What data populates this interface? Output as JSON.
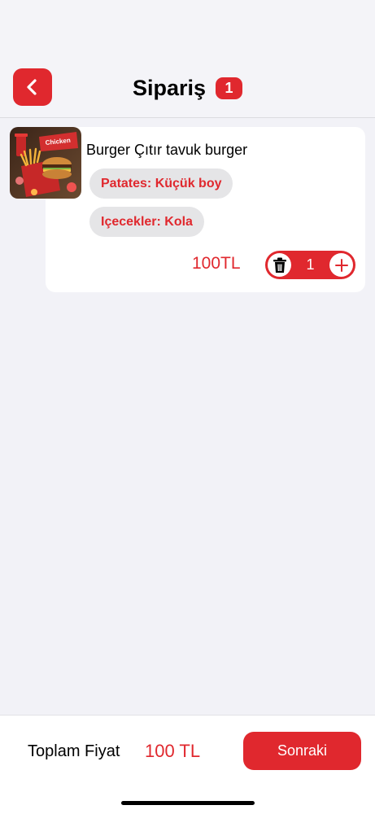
{
  "header": {
    "title": "Sipariş",
    "cart_count": "1"
  },
  "cart": {
    "items": [
      {
        "name": "Burger Çıtır tavuk burger",
        "options": [
          "Patates: Küçük boy",
          "Içecekler: Kola"
        ],
        "price": "100TL",
        "quantity": "1",
        "image_text": "Chicken"
      }
    ]
  },
  "footer": {
    "total_label": "Toplam Fiyat",
    "total_value": "100 TL",
    "next_label": "Sonraki"
  },
  "colors": {
    "accent": "#e0282e",
    "background": "#f2f2f7",
    "chip_bg": "#e5e5e7"
  },
  "icons": {
    "back": "chevron-left-icon",
    "delete": "trash-icon",
    "increment": "plus-icon"
  }
}
